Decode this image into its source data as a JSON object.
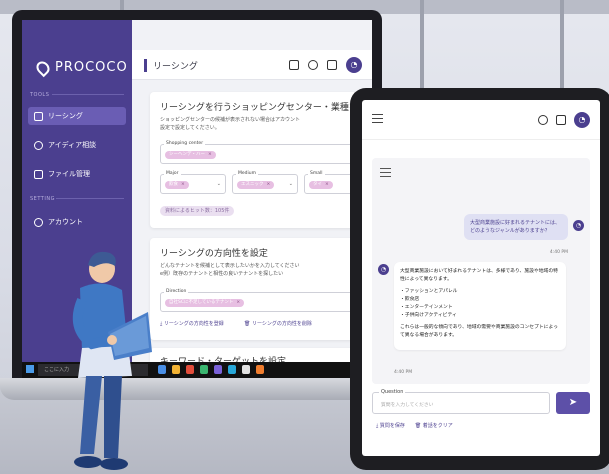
{
  "app": {
    "brand": "PROCOCO",
    "accent_color": "#4b3f8f",
    "chip_color": "#e7bfe2"
  },
  "sidebar": {
    "section_tools": "TOOLS",
    "section_setting": "SETTING",
    "items": [
      {
        "label": "リーシング",
        "icon": "list-icon",
        "active": true
      },
      {
        "label": "アイディア相談",
        "icon": "idea-icon",
        "active": false
      },
      {
        "label": "ファイル管理",
        "icon": "folder-icon",
        "active": false
      },
      {
        "label": "アカウント",
        "icon": "account-icon",
        "active": false
      }
    ]
  },
  "header": {
    "title": "リーシング",
    "icons": [
      "list-view-icon",
      "theme-icon",
      "grid-icon",
      "avatar-icon"
    ]
  },
  "leasing_card": {
    "title": "リーシングを行うショッピングセンター・業種を選択",
    "desc_line1": "ショッピングセンターの候補が表示されない場合はアカウント",
    "desc_line2": "設定で設定してください。",
    "shopping_center_label": "Shopping center",
    "shopping_center_value": "シーヘンデ・ハー",
    "major_label": "Major",
    "major_value": "飲食",
    "medium_label": "Medium",
    "medium_value": "エスニック",
    "small_label": "Small",
    "small_value": "タイ",
    "hits": "資料によるヒット数：105件"
  },
  "direction_card": {
    "title": "リーシングの方向性を設定",
    "desc_line1": "どんなテナントを候補として表示したいかを入力してください",
    "desc_line2": "e例）既存のテナントと相性の良いテナントを探したい",
    "direction_label": "Direction",
    "direction_value": "自社SCに不足しているテナント",
    "save_link": "リーシングの方向性を登録",
    "delete_link": "リーシングの方向性を削除"
  },
  "keyword_card": {
    "title": "キーワード・ターゲットを設定"
  },
  "taskbar": {
    "search_placeholder": "ここに入力"
  },
  "tablet": {
    "user_message": "大型商業施設に好まれるテナントには、どのようなジャンルがありますか？",
    "user_time": "4:40 PM",
    "bot_intro": "大型商業施設において好まれるテナントは、多様であり、施設や地域の特性によって異なります。",
    "bot_items": [
      "・ファッションとアパレル",
      "・飲食店",
      "・エンターテインメント",
      "・子供向けアクティビティ"
    ],
    "bot_outro": "これらは一般的な傾向であり、地域の需要や商業施設のコンセプトによって異なる場合があります。",
    "bot_time": "4:40 PM",
    "question_label": "Question",
    "question_placeholder": "質問を入力してください",
    "save_link": "質問を保存",
    "clear_link": "着話をクリア"
  }
}
